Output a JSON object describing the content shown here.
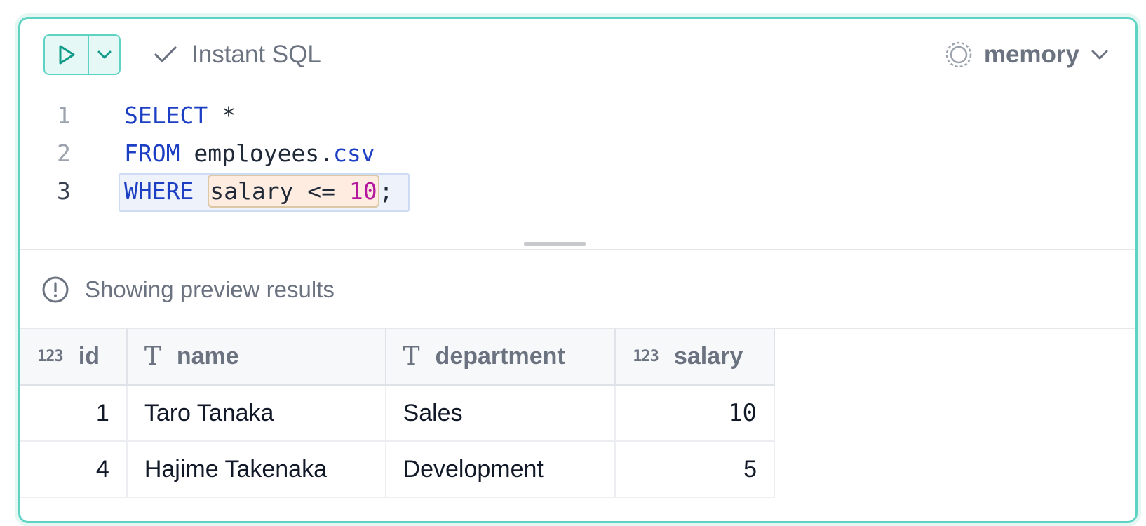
{
  "toolbar": {
    "instant_sql_label": "Instant SQL",
    "database": "memory"
  },
  "editor": {
    "lines": [
      {
        "number": "1"
      },
      {
        "number": "2"
      },
      {
        "number": "3"
      }
    ],
    "tokens": {
      "select": "SELECT",
      "star": "*",
      "from": "FROM",
      "table_name": "employees.",
      "table_ext": "csv",
      "where": "WHERE",
      "cond_col": "salary <= ",
      "cond_val": "10",
      "semicolon": ";"
    }
  },
  "notice": {
    "text": "Showing preview results"
  },
  "results": {
    "columns": [
      {
        "type_label": "123",
        "name": "id"
      },
      {
        "type_label": "T",
        "name": "name"
      },
      {
        "type_label": "T",
        "name": "department"
      },
      {
        "type_label": "123",
        "name": "salary"
      }
    ],
    "rows": [
      {
        "id": "1",
        "name": "Taro Tanaka",
        "department": "Sales",
        "salary": "10"
      },
      {
        "id": "4",
        "name": "Hajime Takenaka",
        "department": "Development",
        "salary": "5"
      }
    ]
  },
  "colors": {
    "accent": "#5fd3c3",
    "keyword": "#1d3fc4",
    "number": "#b5179e"
  },
  "icons": {
    "run": "play-icon",
    "run_dropdown": "chevron-down-icon",
    "instant_sql": "check-icon",
    "database": "database-status-icon",
    "notice": "info-circle-icon"
  }
}
